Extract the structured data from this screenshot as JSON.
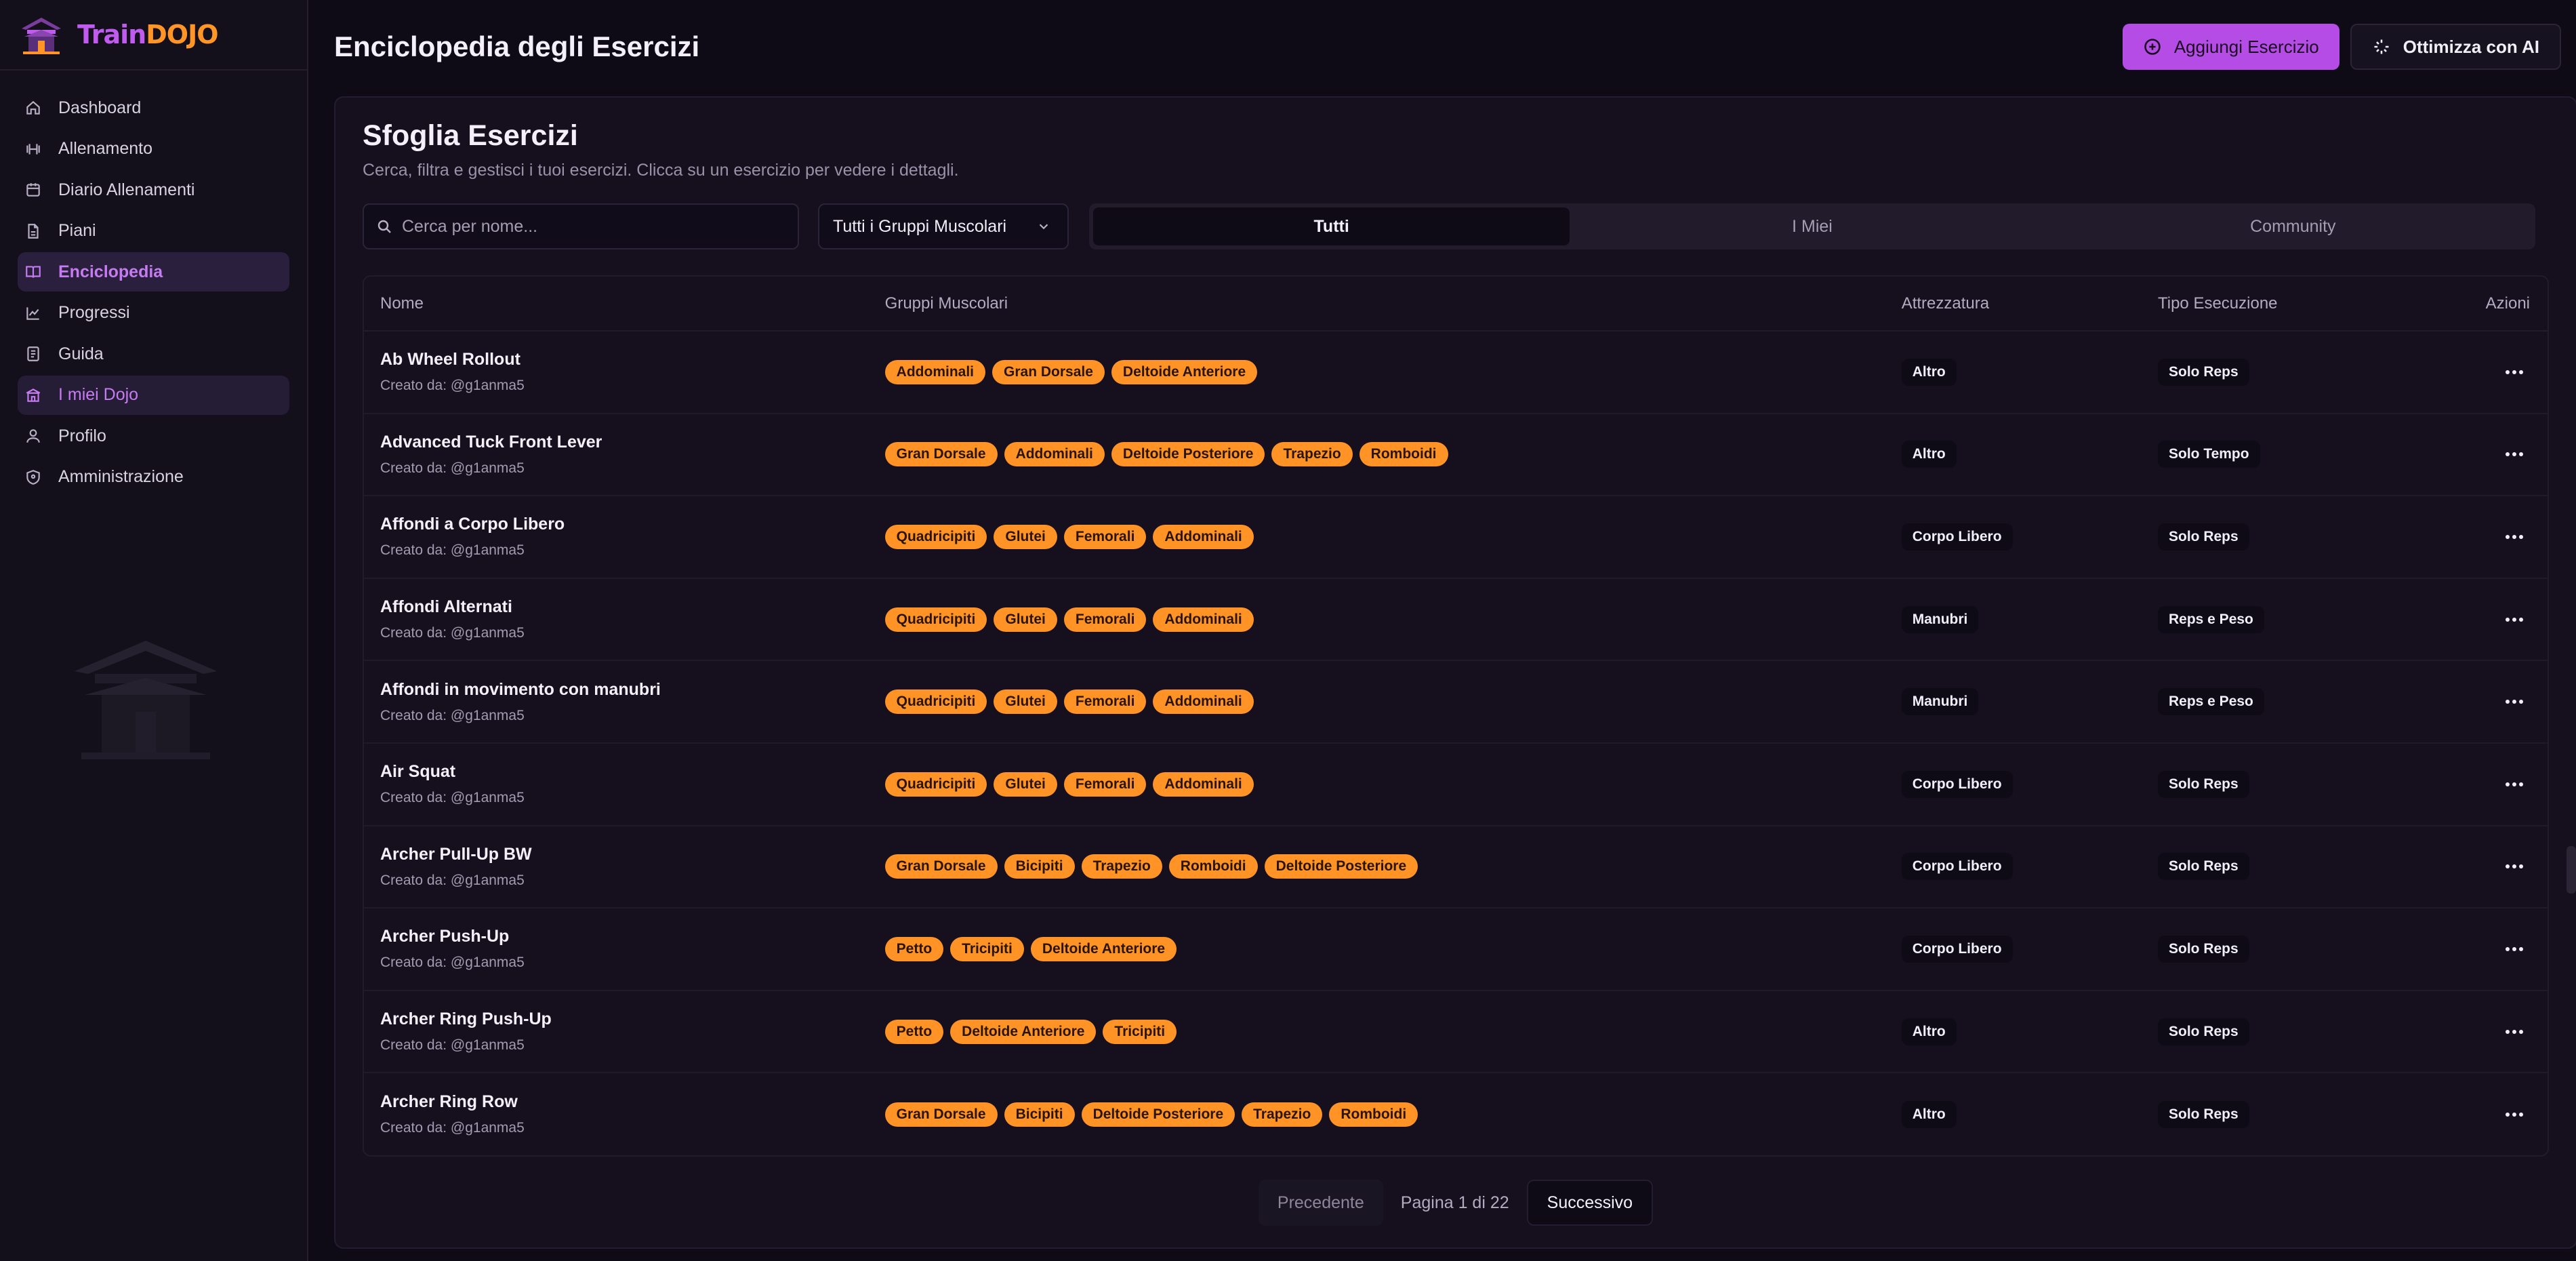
{
  "brand": {
    "part1": "Train",
    "part2": "DOJO"
  },
  "sidebar": {
    "items": [
      {
        "label": "Dashboard",
        "icon": "home-icon",
        "state": ""
      },
      {
        "label": "Allenamento",
        "icon": "dumbbell-icon",
        "state": ""
      },
      {
        "label": "Diario Allenamenti",
        "icon": "calendar-icon",
        "state": ""
      },
      {
        "label": "Piani",
        "icon": "file-icon",
        "state": ""
      },
      {
        "label": "Enciclopedia",
        "icon": "book-icon",
        "state": "active"
      },
      {
        "label": "Progressi",
        "icon": "chart-icon",
        "state": ""
      },
      {
        "label": "Guida",
        "icon": "guide-icon",
        "state": ""
      },
      {
        "label": "I miei Dojo",
        "icon": "dojo-icon",
        "state": "hl"
      },
      {
        "label": "Profilo",
        "icon": "user-icon",
        "state": ""
      },
      {
        "label": "Amministrazione",
        "icon": "shield-icon",
        "state": ""
      }
    ]
  },
  "header": {
    "title": "Enciclopedia degli Esercizi",
    "add_label": "Aggiungi Esercizio",
    "optimize_label": "Ottimizza con AI"
  },
  "browse": {
    "title": "Sfoglia Esercizi",
    "subtitle": "Cerca, filtra e gestisci i tuoi esercizi. Clicca su un esercizio per vedere i dettagli.",
    "search_placeholder": "Cerca per nome...",
    "muscle_filter": "Tutti i Gruppi Muscolari",
    "tabs": [
      {
        "label": "Tutti",
        "active": true
      },
      {
        "label": "I Miei",
        "active": false
      },
      {
        "label": "Community",
        "active": false
      }
    ]
  },
  "table": {
    "headers": {
      "name": "Nome",
      "muscles": "Gruppi Muscolari",
      "equipment": "Attrezzatura",
      "type": "Tipo Esecuzione",
      "actions": "Azioni"
    },
    "rows": [
      {
        "name": "Ab Wheel Rollout",
        "by": "Creato da: @g1anma5",
        "muscles": [
          "Addominali",
          "Gran Dorsale",
          "Deltoide Anteriore"
        ],
        "equipment": "Altro",
        "type": "Solo Reps"
      },
      {
        "name": "Advanced Tuck Front Lever",
        "by": "Creato da: @g1anma5",
        "muscles": [
          "Gran Dorsale",
          "Addominali",
          "Deltoide Posteriore",
          "Trapezio",
          "Romboidi"
        ],
        "equipment": "Altro",
        "type": "Solo Tempo"
      },
      {
        "name": "Affondi a Corpo Libero",
        "by": "Creato da: @g1anma5",
        "muscles": [
          "Quadricipiti",
          "Glutei",
          "Femorali",
          "Addominali"
        ],
        "equipment": "Corpo Libero",
        "type": "Solo Reps"
      },
      {
        "name": "Affondi Alternati",
        "by": "Creato da: @g1anma5",
        "muscles": [
          "Quadricipiti",
          "Glutei",
          "Femorali",
          "Addominali"
        ],
        "equipment": "Manubri",
        "type": "Reps e Peso"
      },
      {
        "name": "Affondi in movimento con manubri",
        "by": "Creato da: @g1anma5",
        "muscles": [
          "Quadricipiti",
          "Glutei",
          "Femorali",
          "Addominali"
        ],
        "equipment": "Manubri",
        "type": "Reps e Peso"
      },
      {
        "name": "Air Squat",
        "by": "Creato da: @g1anma5",
        "muscles": [
          "Quadricipiti",
          "Glutei",
          "Femorali",
          "Addominali"
        ],
        "equipment": "Corpo Libero",
        "type": "Solo Reps"
      },
      {
        "name": "Archer Pull-Up BW",
        "by": "Creato da: @g1anma5",
        "muscles": [
          "Gran Dorsale",
          "Bicipiti",
          "Trapezio",
          "Romboidi",
          "Deltoide Posteriore"
        ],
        "equipment": "Corpo Libero",
        "type": "Solo Reps"
      },
      {
        "name": "Archer Push-Up",
        "by": "Creato da: @g1anma5",
        "muscles": [
          "Petto",
          "Tricipiti",
          "Deltoide Anteriore"
        ],
        "equipment": "Corpo Libero",
        "type": "Solo Reps"
      },
      {
        "name": "Archer Ring Push-Up",
        "by": "Creato da: @g1anma5",
        "muscles": [
          "Petto",
          "Deltoide Anteriore",
          "Tricipiti"
        ],
        "equipment": "Altro",
        "type": "Solo Reps"
      },
      {
        "name": "Archer Ring Row",
        "by": "Creato da: @g1anma5",
        "muscles": [
          "Gran Dorsale",
          "Bicipiti",
          "Deltoide Posteriore",
          "Trapezio",
          "Romboidi"
        ],
        "equipment": "Altro",
        "type": "Solo Reps"
      }
    ]
  },
  "pagination": {
    "prev": "Precedente",
    "info": "Pagina 1 di 22",
    "next": "Successivo"
  },
  "colors": {
    "accent": "#b64ce6",
    "tag": "#ff9326",
    "bg": "#0f0b16"
  }
}
